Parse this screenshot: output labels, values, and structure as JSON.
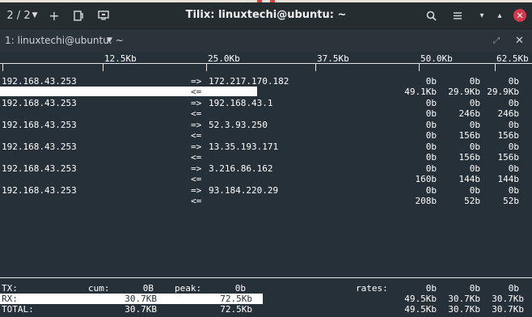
{
  "titlebar": {
    "session_counter": "2 / 2",
    "title": "Tilix: linuxtechi@ubuntu: ~",
    "icons": [
      "chevron-down-icon",
      "add-icon",
      "split-icon",
      "notification-icon",
      "search-icon",
      "menu-icon",
      "minimize-icon",
      "maximize-icon",
      "close-icon"
    ]
  },
  "tab": {
    "label": "1: linuxtechi@ubuntu: ~"
  },
  "scale": {
    "ticks": [
      "12.5Kb",
      "25.0Kb",
      "37.5Kb",
      "50.0Kb",
      "62.5Kb"
    ]
  },
  "connections": [
    {
      "src": "192.168.43.253",
      "dst": "172.217.170.182",
      "tx": [
        "0b",
        "0b",
        "0b"
      ],
      "rx": [
        "49.1Kb",
        "29.9Kb",
        "29.9Kb"
      ]
    },
    {
      "src": "192.168.43.253",
      "dst": "192.168.43.1",
      "tx": [
        "0b",
        "0b",
        "0b"
      ],
      "rx": [
        "0b",
        "246b",
        "246b"
      ]
    },
    {
      "src": "192.168.43.253",
      "dst": "52.3.93.250",
      "tx": [
        "0b",
        "0b",
        "0b"
      ],
      "rx": [
        "0b",
        "156b",
        "156b"
      ]
    },
    {
      "src": "192.168.43.253",
      "dst": "13.35.193.171",
      "tx": [
        "0b",
        "0b",
        "0b"
      ],
      "rx": [
        "0b",
        "156b",
        "156b"
      ]
    },
    {
      "src": "192.168.43.253",
      "dst": "3.216.86.162",
      "tx": [
        "0b",
        "0b",
        "0b"
      ],
      "rx": [
        "160b",
        "144b",
        "144b"
      ]
    },
    {
      "src": "192.168.43.253",
      "dst": "93.184.220.29",
      "tx": [
        "0b",
        "0b",
        "0b"
      ],
      "rx": [
        "208b",
        "52b",
        "52b"
      ]
    }
  ],
  "arrows": {
    "out": "=>",
    "in": "<="
  },
  "footer": {
    "tx": {
      "label": "TX:",
      "cum_label": "cum:",
      "cum": "0B",
      "peak_label": "peak:",
      "peak": "0b",
      "rates_label": "rates:",
      "rates": [
        "0b",
        "0b",
        "0b"
      ]
    },
    "rx": {
      "label": "RX:",
      "cum": "30.7KB",
      "peak": "72.5Kb",
      "rates": [
        "49.5Kb",
        "30.7Kb",
        "30.7Kb"
      ]
    },
    "total": {
      "label": "TOTAL:",
      "cum": "30.7KB",
      "peak": "72.5Kb",
      "rates": [
        "49.5Kb",
        "30.7Kb",
        "30.7Kb"
      ]
    }
  }
}
